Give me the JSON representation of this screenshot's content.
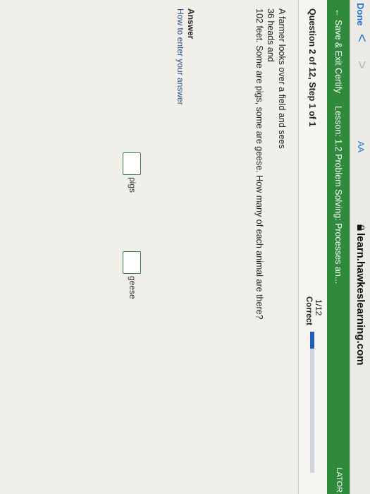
{
  "browser": {
    "done_label": "Done",
    "back_glyph": "<",
    "forward_glyph": ">",
    "text_size_label": "AA",
    "url": "learn.hawkeslearning.com",
    "lock_icon": "lock-icon"
  },
  "lesson_bar": {
    "save_exit_label": "← Save & Exit Certify",
    "lesson_title": "Lesson: 1.2 Problem Solving: Processes an...",
    "calculator_label": "LATOR"
  },
  "question": {
    "title": "Question 2 of 12, Step 1 of 1",
    "progress_count": "1/12",
    "progress_label": "Correct",
    "progress_fraction": 0.12
  },
  "problem": {
    "lines": [
      "A farmer looks over a field and sees",
      "36 heads and",
      "102 feet. Some are pigs, some are geese. How many of each animal are there?"
    ]
  },
  "answer": {
    "label": "Answer",
    "help_link": "How to enter your answer",
    "fields": [
      {
        "value": "",
        "unit": "pigs"
      },
      {
        "value": "",
        "unit": "geese"
      }
    ]
  },
  "colors": {
    "accent_green": "#2f8a3c",
    "progress_blue": "#1f5db8",
    "link_blue": "#1f74d8"
  }
}
